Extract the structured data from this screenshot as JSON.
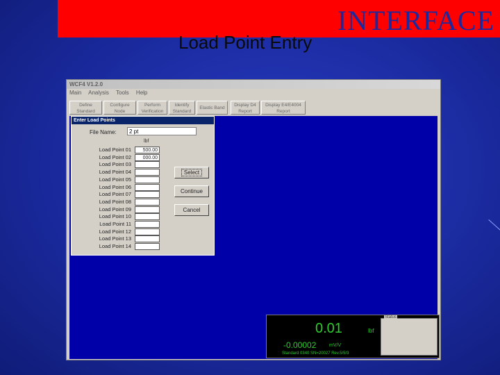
{
  "slide": {
    "banner_title": "INTERFACE",
    "subtitle": "Load Point Entry",
    "banner_color": "#ff0000",
    "background_color": "#1a2a9e"
  },
  "app": {
    "title": "WCF4 V1.2.0",
    "menu": [
      "Main",
      "Analysis",
      "Tools",
      "Help"
    ],
    "toolbar": [
      {
        "label": "Define\nStandard"
      },
      {
        "label": "Configure\nNode"
      },
      {
        "label": "Perform\nVerification"
      },
      {
        "label": "Identify\nStandard"
      },
      {
        "label": "Elastic Band"
      },
      {
        "label": "Display D4\nReport"
      },
      {
        "label": "Display E4/E4004\nReport"
      }
    ]
  },
  "dialog": {
    "title": "Enter Load Points",
    "file_name_label": "File Name:",
    "file_name_value": "2 pt",
    "unit": "lbf",
    "load_points": [
      {
        "label": "Load Point 01",
        "value": "500.00"
      },
      {
        "label": "Load Point 02",
        "value": "000.00"
      },
      {
        "label": "Load Point 03",
        "value": ""
      },
      {
        "label": "Load Point 04",
        "value": ""
      },
      {
        "label": "Load Point 05",
        "value": ""
      },
      {
        "label": "Load Point 06",
        "value": ""
      },
      {
        "label": "Load Point 07",
        "value": ""
      },
      {
        "label": "Load Point 08",
        "value": ""
      },
      {
        "label": "Load Point 09",
        "value": ""
      },
      {
        "label": "Load Point 10",
        "value": ""
      },
      {
        "label": "Load Point 11",
        "value": ""
      },
      {
        "label": "Load Point 12",
        "value": ""
      },
      {
        "label": "Load Point 13",
        "value": ""
      },
      {
        "label": "Load Point 14",
        "value": ""
      }
    ],
    "buttons": {
      "select": "Select",
      "continue": "Continue",
      "cancel": "Cancel"
    }
  },
  "readout": {
    "value": "0.01",
    "unit": "lbf",
    "mv_value": "-0.00002",
    "mv_unit": "mV/V",
    "standard_info": "Standard 0340 SN=20027 Rev.5/5/3",
    "status_label": "Status",
    "value_color": "#2ecc2e"
  }
}
